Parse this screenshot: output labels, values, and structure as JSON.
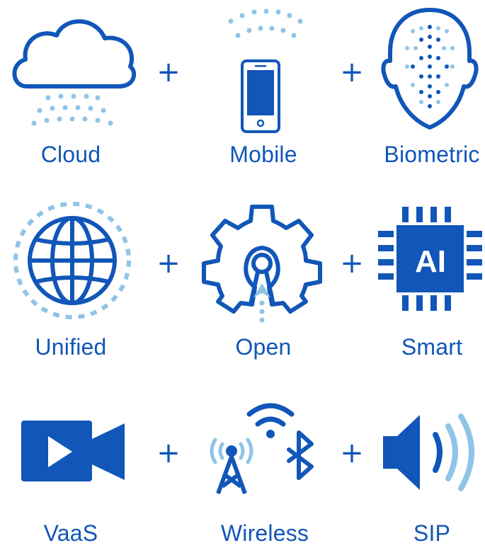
{
  "colors": {
    "primary": "#1156b8",
    "light": "#8fc4e6"
  },
  "separator": "+",
  "row1": {
    "labels": [
      "Cloud",
      "Mobile",
      "Biometric"
    ],
    "icons": [
      "cloud-icon",
      "mobile-phone-icon",
      "face-biometric-icon"
    ]
  },
  "row2": {
    "labels": [
      "Unified",
      "Open",
      "Smart"
    ],
    "icons": [
      "globe-icon",
      "gear-keyhole-icon",
      "ai-chip-icon"
    ]
  },
  "row3": {
    "labels": [
      "VaaS",
      "Wireless",
      "SIP"
    ],
    "icons": [
      "video-camera-icon",
      "wireless-tower-wifi-bluetooth-icon",
      "speaker-icon"
    ]
  },
  "chip_text": "AI"
}
